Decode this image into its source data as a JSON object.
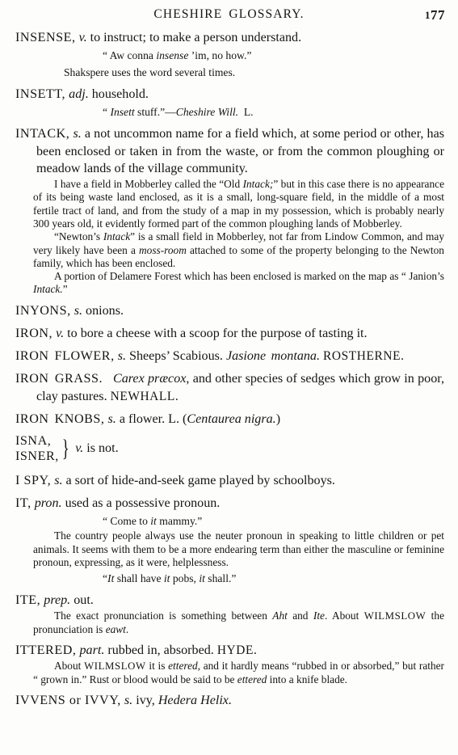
{
  "page": {
    "running_head": "CHESHIRE  GLOSSARY.",
    "folio": "177",
    "folio_first_digit": "1",
    "folio_rest": "77"
  },
  "entries": [
    {
      "id": "insense",
      "headword": "INSENSE,",
      "pos": "v.",
      "definition": " to instruct; to make a person understand.",
      "quote": "“ Aw conna insense ’im, no how.”",
      "quote_italic_word": "insense",
      "quote_pre": "“ Aw conna ",
      "quote_post": " ’im, no how.”",
      "note": "Shakspere uses the word several times."
    },
    {
      "id": "insett",
      "headword": "INSETT,",
      "pos": "adj.",
      "definition": " household.",
      "quote_pre": "“ ",
      "quote_italic_word": "Insett",
      "quote_mid": " stuff.”—",
      "quote_source_italic": "Cheshire Will.",
      "quote_authority": "L."
    },
    {
      "id": "intack",
      "headword": "INTACK,",
      "pos": "s.",
      "definition": " a not uncommon name for a field which, at some period or other, has been enclosed or taken in from the waste, or from the common ploughing or meadow lands of the village community.",
      "notes": [
        {
          "segments": [
            {
              "t": "I have a field in Mobberley called the “Old ",
              "s": "roman"
            },
            {
              "t": "Intack;",
              "s": "italic"
            },
            {
              "t": "” but in this case there is no appearance of its being waste land enclosed, as it is a small, long-square field, in the middle of a most fertile tract of land, and from the study of a map in my possession, which is probably nearly 300 years old, it evidently formed part of the common ploughing lands of Mobberley.",
              "s": "roman"
            }
          ]
        },
        {
          "segments": [
            {
              "t": "“Newton’s ",
              "s": "roman"
            },
            {
              "t": "Intack",
              "s": "italic"
            },
            {
              "t": "” is a small field in Mobberley, not far from Lindow Common, and may very likely have been a ",
              "s": "roman"
            },
            {
              "t": "moss-room",
              "s": "italic"
            },
            {
              "t": " attached to some of the property belonging to the Newton family, which has been enclosed.",
              "s": "roman"
            }
          ]
        },
        {
          "segments": [
            {
              "t": "A portion of Delamere Forest which has been enclosed is marked on the map as “ Janion’s ",
              "s": "roman"
            },
            {
              "t": "Intack.",
              "s": "italic"
            },
            {
              "t": "”",
              "s": "roman"
            }
          ]
        }
      ]
    },
    {
      "id": "inyons",
      "headword": "INYONS,",
      "pos": "s.",
      "definition": " onions."
    },
    {
      "id": "iron",
      "headword": "IRON,",
      "pos": "v.",
      "definition": " to bore a cheese with a scoop for the purpose of tasting it."
    },
    {
      "id": "iron-flower",
      "headword": "IRON  FLOWER,",
      "pos": "s.",
      "definition": "  Sheeps’ Scabious.  ",
      "latin": "Jasione  montana.",
      "authority": "ROSTHERNE."
    },
    {
      "id": "iron-grass",
      "headword": "IRON  GRASS.",
      "latin": "Carex præcox",
      "definition": ", and other species of sedges which grow in poor, clay pastures.  ",
      "authority": "NEWHALL."
    },
    {
      "id": "iron-knobs",
      "headword": "IRON  KNOBS,",
      "pos": "s.",
      "definition": " a flower.   L.   (",
      "latin": "Centaurea nigra.",
      "definition_tail": ")"
    },
    {
      "id": "isna-isner",
      "headword_line_1": "ISNA,",
      "headword_line_2": "ISNER,",
      "brace": "}",
      "pos": "v.",
      "definition": " is not."
    },
    {
      "id": "i-spy",
      "headword": "I SPY,",
      "pos": "s.",
      "definition": " a sort of hide-and-seek game played by schoolboys."
    },
    {
      "id": "it",
      "headword": "IT,",
      "pos": "pron.",
      "definition": " used as a possessive pronoun.",
      "quote_pre": "“ Come to ",
      "quote_italic_word": "it",
      "quote_post": " mammy.”",
      "notes": [
        {
          "segments": [
            {
              "t": "The country people always use the neuter pronoun in speaking to little children or pet animals.   It seems with them to be a more endearing term than either the masculine or feminine pronoun, expressing, as it were, helplessness.",
              "s": "roman"
            }
          ]
        }
      ],
      "quote2_segments": [
        {
          "t": "“",
          "s": "roman"
        },
        {
          "t": "It",
          "s": "italic"
        },
        {
          "t": " shall have ",
          "s": "roman"
        },
        {
          "t": "it",
          "s": "italic"
        },
        {
          "t": " pobs, ",
          "s": "roman"
        },
        {
          "t": "it",
          "s": "italic"
        },
        {
          "t": " shall.”",
          "s": "roman"
        }
      ]
    },
    {
      "id": "ite",
      "headword": "ITE,",
      "pos": "prep.",
      "definition": " out.",
      "notes": [
        {
          "segments": [
            {
              "t": "The exact pronunciation is something between ",
              "s": "roman"
            },
            {
              "t": "Aht",
              "s": "italic"
            },
            {
              "t": " and ",
              "s": "roman"
            },
            {
              "t": "Ite",
              "s": "italic"
            },
            {
              "t": ".   About ",
              "s": "roman"
            },
            {
              "t": "WILMSLOW",
              "s": "smallcaps"
            },
            {
              "t": " the pronunciation is ",
              "s": "roman"
            },
            {
              "t": "eawt",
              "s": "italic"
            },
            {
              "t": ".",
              "s": "roman"
            }
          ]
        }
      ]
    },
    {
      "id": "ittered",
      "headword": "ITTERED,",
      "pos": "part.",
      "definition": " rubbed in, absorbed.   ",
      "authority": "HYDE.",
      "notes": [
        {
          "segments": [
            {
              "t": "About ",
              "s": "roman"
            },
            {
              "t": "WILMSLOW",
              "s": "smallcaps"
            },
            {
              "t": " it is ",
              "s": "roman"
            },
            {
              "t": "ettered",
              "s": "italic"
            },
            {
              "t": ", and it hardly means  “rubbed in or absorbed,” but rather  “ grown in.”   Rust or blood would be said to be ",
              "s": "roman"
            },
            {
              "t": "ettered",
              "s": "italic"
            },
            {
              "t": " into a knife blade.",
              "s": "roman"
            }
          ]
        }
      ]
    },
    {
      "id": "ivvens",
      "headword": "IVVENS or IVVY,",
      "pos": "s.",
      "definition": " ivy, ",
      "latin": "Hedera Helix.",
      "definition_tail": ""
    }
  ]
}
